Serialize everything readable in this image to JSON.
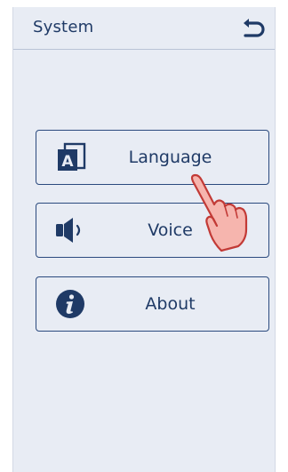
{
  "header": {
    "title": "System",
    "back_icon": "back-arrow-icon"
  },
  "menu": [
    {
      "label": "Language",
      "icon": "language-icon"
    },
    {
      "label": "Voice",
      "icon": "speaker-icon"
    },
    {
      "label": "About",
      "icon": "info-icon"
    }
  ],
  "overlay": {
    "icon": "pointing-hand-icon"
  },
  "colors": {
    "background": "#e8ecf4",
    "primary": "#1f3a66",
    "border": "#2b4a7e",
    "hand_fill": "#f6b5ae",
    "hand_stroke": "#c23a36"
  }
}
